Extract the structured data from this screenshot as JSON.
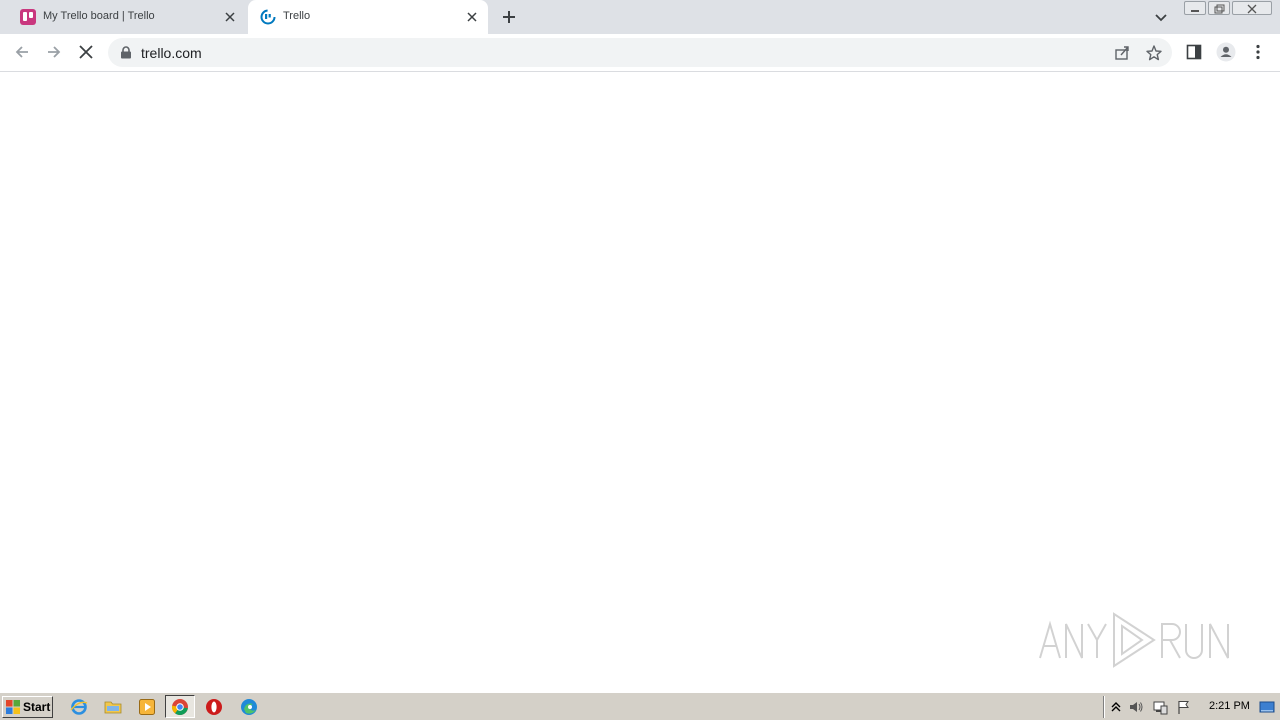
{
  "browser": {
    "tabs": [
      {
        "title": "My Trello board | Trello",
        "favicon": "trello-board-favicon",
        "active": false
      },
      {
        "title": "Trello",
        "favicon": "trello-loading-favicon",
        "active": true
      }
    ],
    "new_tab_icon": "plus-icon",
    "tab_search_icon": "chevron-down-icon",
    "toolbar": {
      "back_icon": "arrow-left-icon",
      "forward_icon": "arrow-right-icon",
      "stop_icon": "close-icon",
      "url": "trello.com"
    }
  },
  "watermark": {
    "text": "ANY RUN"
  },
  "taskbar": {
    "start_label": "Start",
    "quick_launch": [
      "internet-explorer-icon",
      "folder-icon",
      "media-player-icon",
      "chrome-icon",
      "opera-icon",
      "edge-icon"
    ],
    "clock": "2:21 PM"
  },
  "colors": {
    "tabstrip": "#dee1e6",
    "omnibox": "#f1f3f4",
    "trello_pink": "#c9377e",
    "trello_blue": "#0079bf",
    "taskbar": "#d4d0c8"
  }
}
